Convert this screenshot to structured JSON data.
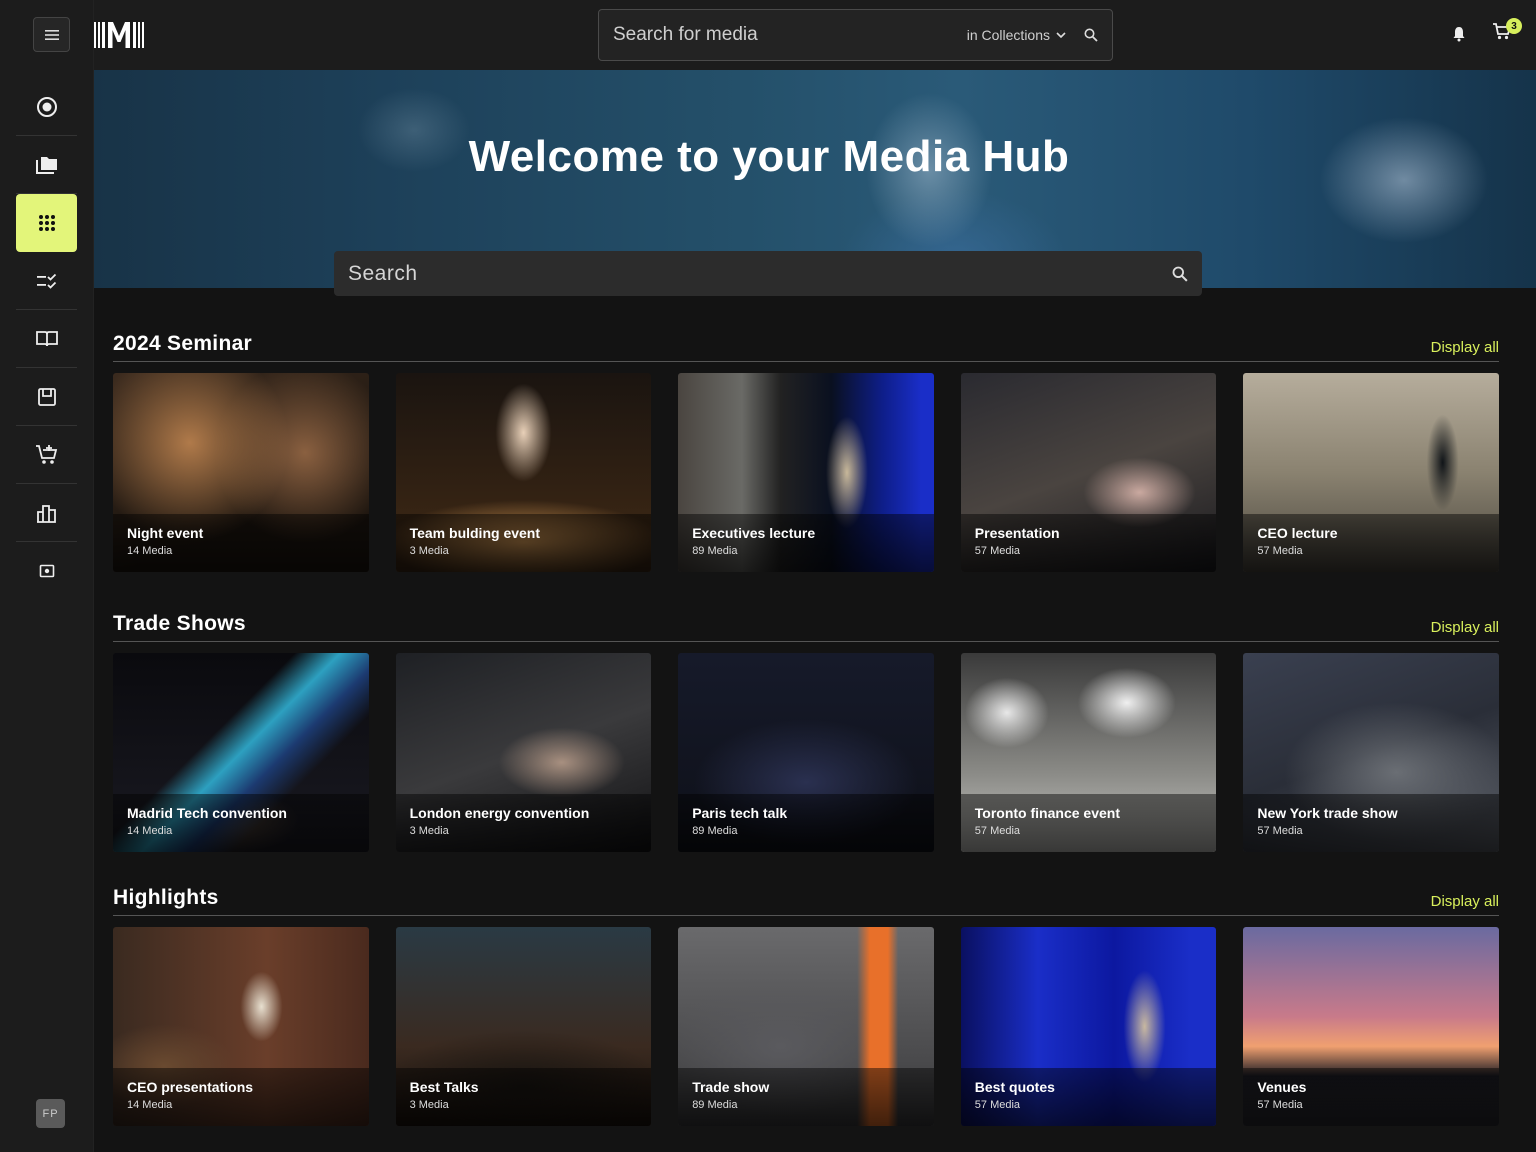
{
  "app": {
    "logo_text": "IIMII"
  },
  "header": {
    "search_placeholder": "Search for media",
    "scope_label": "in Collections",
    "cart_count": "3"
  },
  "sidebar": {
    "items": [
      {
        "icon": "target-icon",
        "label": ""
      },
      {
        "icon": "folders-icon",
        "label": ""
      },
      {
        "icon": "grid-icon",
        "label": "",
        "active": true
      },
      {
        "icon": "checklist-icon",
        "label": ""
      },
      {
        "icon": "book-icon",
        "label": ""
      },
      {
        "icon": "archive-icon",
        "label": ""
      },
      {
        "icon": "cart-add-icon",
        "label": ""
      },
      {
        "icon": "bar-chart-icon",
        "label": ""
      },
      {
        "icon": "image-frame-icon",
        "label": ""
      }
    ],
    "user_initials": "FP"
  },
  "hero": {
    "title": "Welcome to your Media Hub",
    "search_placeholder": "Search"
  },
  "sections": [
    {
      "title": "2024 Seminar",
      "action": "Display all",
      "cards": [
        {
          "title": "Night event",
          "meta": "14 Media"
        },
        {
          "title": "Team bulding event",
          "meta": "3 Media"
        },
        {
          "title": "Executives lecture",
          "meta": "89 Media"
        },
        {
          "title": "Presentation",
          "meta": "57 Media"
        },
        {
          "title": "CEO lecture",
          "meta": "57 Media"
        }
      ]
    },
    {
      "title": "Trade Shows",
      "action": "Display all",
      "cards": [
        {
          "title": "Madrid Tech convention",
          "meta": "14 Media"
        },
        {
          "title": "London energy convention",
          "meta": "3 Media"
        },
        {
          "title": "Paris tech talk",
          "meta": "89 Media"
        },
        {
          "title": "Toronto finance event",
          "meta": "57 Media"
        },
        {
          "title": "New York trade show",
          "meta": "57 Media"
        }
      ]
    },
    {
      "title": "Highlights",
      "action": "Display all",
      "cards": [
        {
          "title": "CEO presentations",
          "meta": "14 Media"
        },
        {
          "title": "Best Talks",
          "meta": "3 Media"
        },
        {
          "title": "Trade show",
          "meta": "89 Media"
        },
        {
          "title": "Best quotes",
          "meta": "57 Media"
        },
        {
          "title": "Venues",
          "meta": "57 Media"
        }
      ]
    }
  ],
  "colors": {
    "accent": "#e3f57a",
    "link": "#d9f05c",
    "background": "#131313",
    "sidebar": "#1c1c1c"
  }
}
